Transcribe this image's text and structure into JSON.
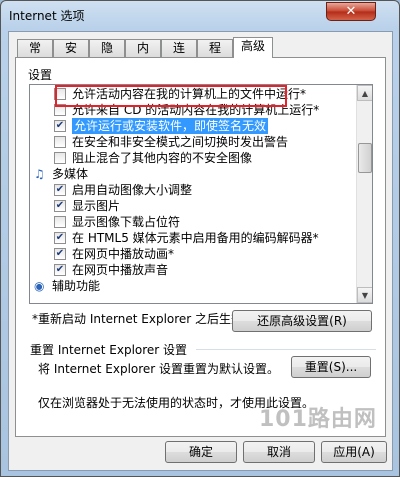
{
  "window": {
    "title": "Internet 选项",
    "close_glyph": "✕"
  },
  "tabs": [
    {
      "label": "常规"
    },
    {
      "label": "安全"
    },
    {
      "label": "隐私"
    },
    {
      "label": "内容"
    },
    {
      "label": "连接"
    },
    {
      "label": "程序"
    },
    {
      "label": "高级"
    }
  ],
  "settings": {
    "group_label": "设置",
    "items": [
      {
        "type": "check",
        "checked": false,
        "indent": 2,
        "label": "允许活动内容在我的计算机上的文件中运行*"
      },
      {
        "type": "check",
        "checked": false,
        "indent": 2,
        "label": "允许来自 CD 的活动内容在我的计算机上运行*"
      },
      {
        "type": "check",
        "checked": true,
        "indent": 2,
        "label": "允许运行或安装软件，即使签名无效",
        "selected": true
      },
      {
        "type": "check",
        "checked": false,
        "indent": 2,
        "label": "在安全和非安全模式之间切换时发出警告"
      },
      {
        "type": "check",
        "checked": false,
        "indent": 2,
        "label": "阻止混合了其他内容的不安全图像"
      },
      {
        "type": "category",
        "indent": 1,
        "label": "多媒体",
        "icon": "multimedia-icon"
      },
      {
        "type": "check",
        "checked": true,
        "indent": 2,
        "label": "启用自动图像大小调整"
      },
      {
        "type": "check",
        "checked": true,
        "indent": 2,
        "label": "显示图片"
      },
      {
        "type": "check",
        "checked": false,
        "indent": 2,
        "label": "显示图像下载占位符"
      },
      {
        "type": "check",
        "checked": true,
        "indent": 2,
        "label": "在 HTML5 媒体元素中启用备用的编码解码器*"
      },
      {
        "type": "check",
        "checked": true,
        "indent": 2,
        "label": "在网页中播放动画*"
      },
      {
        "type": "check",
        "checked": true,
        "indent": 2,
        "label": "在网页中播放声音"
      },
      {
        "type": "category",
        "indent": 1,
        "label": "辅助功能",
        "icon": "accessibility-icon"
      }
    ],
    "restart_note": "*重新启动 Internet Explorer 之后生效",
    "restore_button": "还原高级设置(R)"
  },
  "reset": {
    "section_title": "重置 Internet Explorer 设置",
    "description": "将 Internet Explorer 设置重置为默认设置。",
    "button": "重置(S)...",
    "note": "仅在浏览器处于无法使用的状态时，才使用此设置。"
  },
  "footer": {
    "ok": "确定",
    "cancel": "取消",
    "apply": "应用(A)"
  },
  "watermark": "101路由网"
}
